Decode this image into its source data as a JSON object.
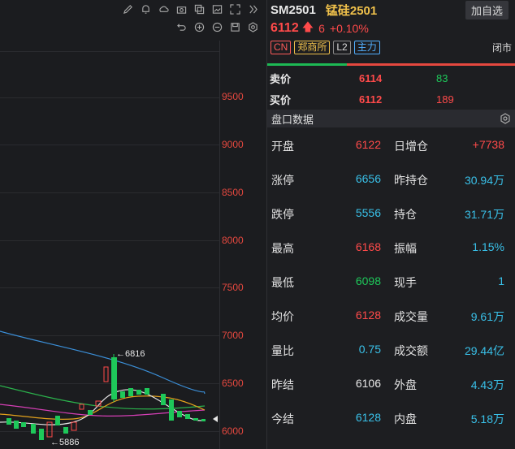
{
  "toolbar": {
    "row1": [
      "pencil-icon",
      "bell-icon",
      "cloud-icon",
      "camera-icon",
      "copy-icon",
      "image-icon",
      "expand-icon",
      "chevron-right-icon"
    ],
    "row2": [
      "undo-icon",
      "zoom-in-icon",
      "zoom-out-icon",
      "save-icon",
      "settings-icon"
    ]
  },
  "chart": {
    "price_ticks": [
      "9500",
      "9000",
      "8500",
      "8000",
      "7500",
      "7000",
      "6500",
      "6000"
    ],
    "high_marker": "←6816",
    "low_marker": "←5886"
  },
  "quote": {
    "symbol": "SM2501",
    "name": "锰硅2501",
    "add_button": "加自选",
    "last_price": "6112",
    "arrow": "🡅",
    "change": "6",
    "change_pct": "+0.10%",
    "tags": [
      "CN",
      "郑商所",
      "L2",
      "主力"
    ],
    "status": "闭市",
    "orderbook": [
      {
        "label": "卖价",
        "price": "6114",
        "vol": "83",
        "vol_color": "green"
      },
      {
        "label": "买价",
        "price": "6112",
        "vol": "189",
        "vol_color": "red"
      }
    ],
    "section_title": "盘口数据",
    "stats": [
      {
        "l": "开盘",
        "lv": "6122",
        "lc": "red",
        "r": "日增仓",
        "rv": "+7738",
        "rc": "red"
      },
      {
        "l": "涨停",
        "lv": "6656",
        "lc": "cyan",
        "r": "昨持仓",
        "rv": "30.94万",
        "rc": "cyan"
      },
      {
        "l": "跌停",
        "lv": "5556",
        "lc": "cyan",
        "r": "持仓",
        "rv": "31.71万",
        "rc": "cyan"
      },
      {
        "l": "最高",
        "lv": "6168",
        "lc": "red",
        "r": "振幅",
        "rv": "1.15%",
        "rc": "cyan"
      },
      {
        "l": "最低",
        "lv": "6098",
        "lc": "green",
        "r": "现手",
        "rv": "1",
        "rc": "cyan"
      },
      {
        "l": "均价",
        "lv": "6128",
        "lc": "red",
        "r": "成交量",
        "rv": "9.61万",
        "rc": "cyan"
      },
      {
        "l": "量比",
        "lv": "0.75",
        "lc": "cyan",
        "r": "成交额",
        "rv": "29.44亿",
        "rc": "cyan"
      },
      {
        "l": "昨结",
        "lv": "6106",
        "lc": "white",
        "r": "外盘",
        "rv": "4.43万",
        "rc": "cyan"
      },
      {
        "l": "今结",
        "lv": "6128",
        "lc": "cyan",
        "r": "内盘",
        "rv": "5.18万",
        "rc": "cyan"
      }
    ]
  }
}
